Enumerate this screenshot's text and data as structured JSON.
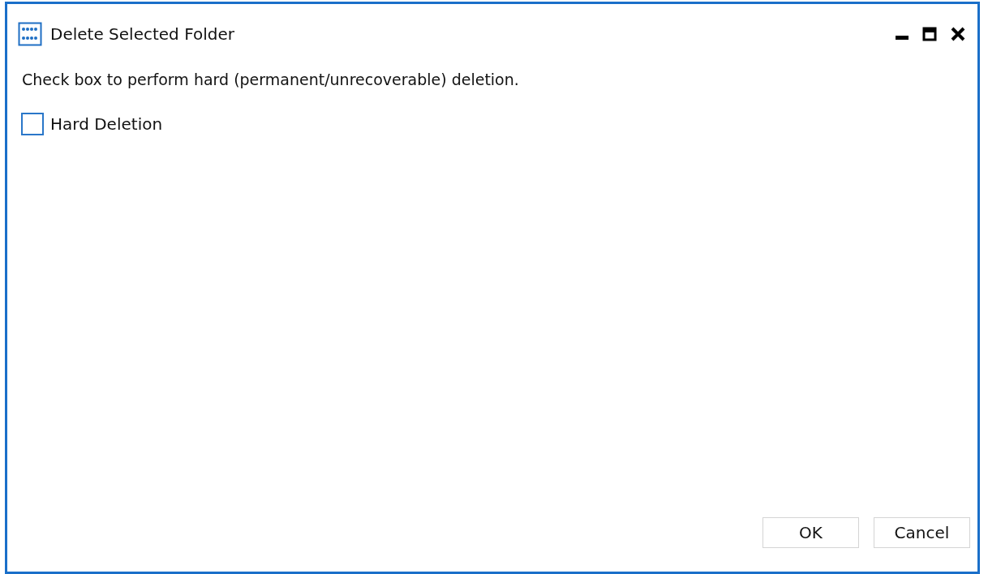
{
  "window": {
    "title": "Delete Selected Folder"
  },
  "message": "Check box to perform hard (permanent/unrecoverable) deletion.",
  "options": [
    {
      "label": "Hard Deletion",
      "checked": false
    }
  ],
  "buttons": [
    "OK",
    "Cancel"
  ]
}
